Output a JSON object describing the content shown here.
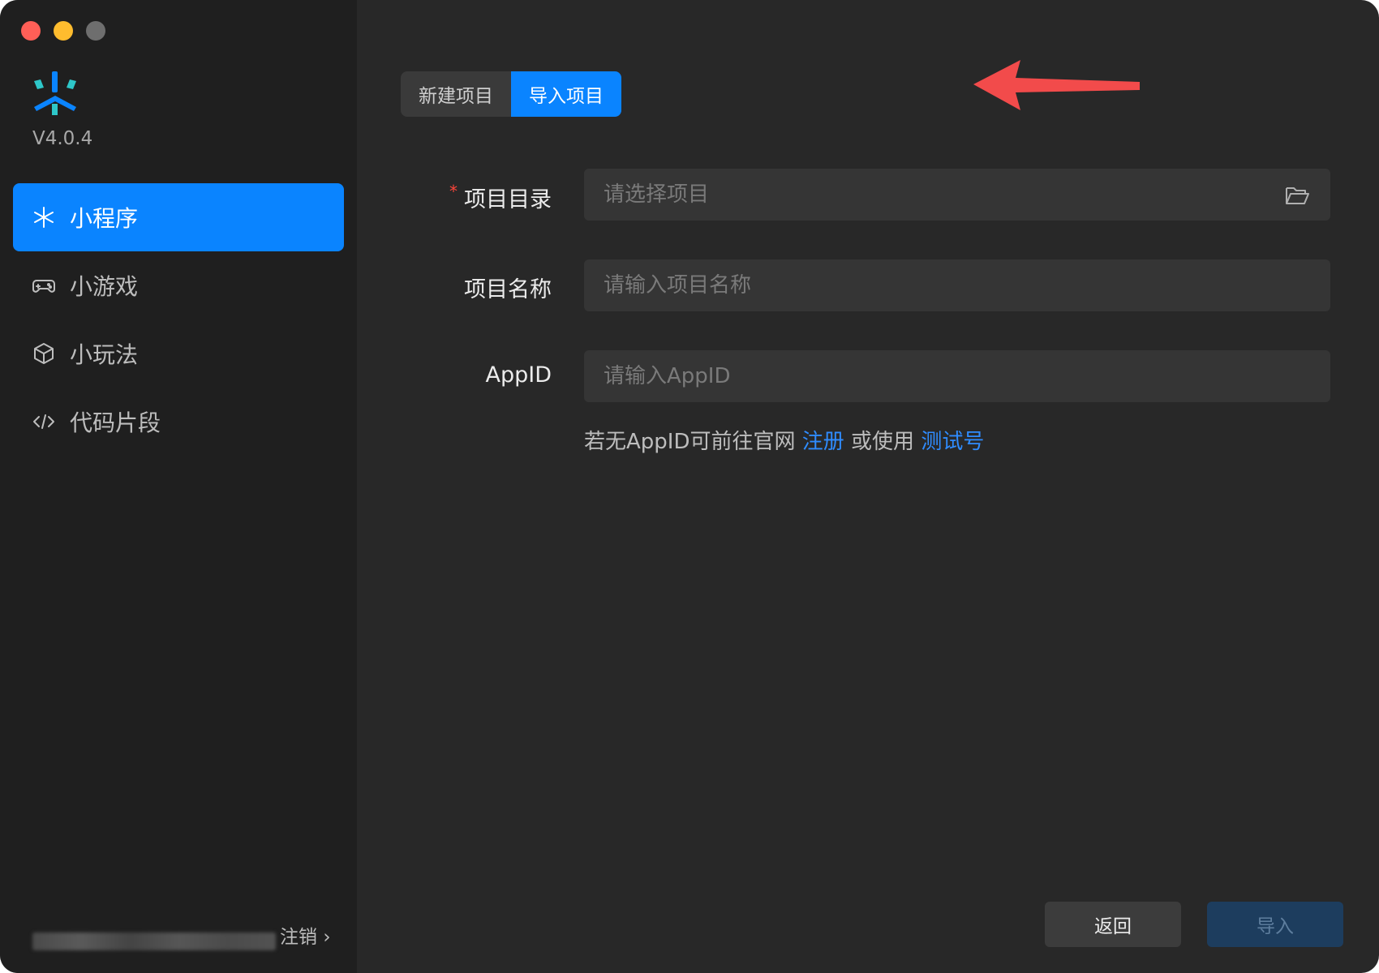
{
  "app": {
    "version": "V4.0.4",
    "accent_color": "#0a84ff"
  },
  "sidebar": {
    "items": [
      {
        "label": "小程序",
        "icon": "mini-program-icon",
        "active": true
      },
      {
        "label": "小游戏",
        "icon": "gamepad-icon",
        "active": false
      },
      {
        "label": "小玩法",
        "icon": "cube-icon",
        "active": false
      },
      {
        "label": "代码片段",
        "icon": "code-icon",
        "active": false
      }
    ],
    "logout_label": "注销",
    "logout_chevron": "›"
  },
  "main": {
    "tabs": [
      {
        "label": "新建项目",
        "selected": false
      },
      {
        "label": "导入项目",
        "selected": true
      }
    ],
    "form": {
      "directory": {
        "label": "项目目录",
        "required_mark": "*",
        "placeholder": "请选择项目",
        "value": ""
      },
      "name": {
        "label": "项目名称",
        "placeholder": "请输入项目名称",
        "value": ""
      },
      "appid": {
        "label": "AppID",
        "placeholder": "请输入AppID",
        "value": ""
      }
    },
    "hint": {
      "prefix": "若无AppID可前往官网",
      "register_link": "注册",
      "middle": "或使用",
      "test_link": "测试号"
    },
    "buttons": {
      "back": "返回",
      "import": "导入"
    }
  }
}
